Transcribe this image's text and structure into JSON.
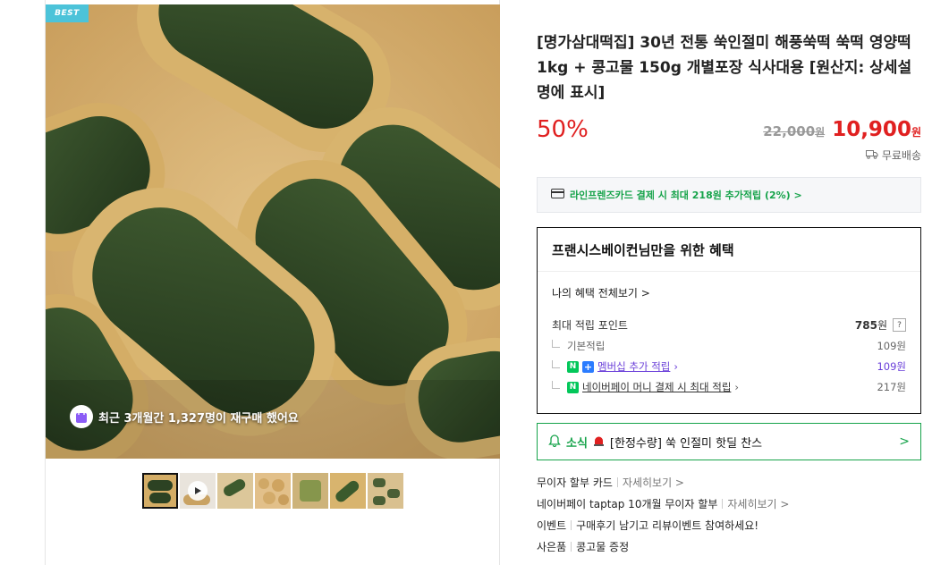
{
  "gallery": {
    "badge": "BEST",
    "repurchase_text": "최근 3개월간 1,327명이 재구매 했어요",
    "thumb_count": 7
  },
  "product": {
    "title": "[명가삼대떡집] 30년 전통 쑥인절미 해풍쑥떡 쑥떡 영양떡 1kg + 콩고물 150g 개별포장 식사대용 [원산지: 상세설명에 표시]",
    "discount": "50%",
    "original_price": "22,000",
    "original_unit": "원",
    "sale_price": "10,900",
    "sale_unit": "원",
    "shipping": "무료배송"
  },
  "card_promo": "라인프렌즈카드 결제 시 최대 218원 추가적립 (2%) >",
  "benefit": {
    "title": "프랜시스베이컨님만을 위한 혜택",
    "view_all": "나의 혜택 전체보기 >",
    "max_points_label": "최대 적립 포인트",
    "max_points_value": "785",
    "max_points_unit": "원",
    "qmark": "?",
    "basic_label": "기본적립",
    "basic_value": "109원",
    "membership_label": "멤버십 추가 적립",
    "membership_value": "109원",
    "npay_label": "네이버페이 머니 결제 시 최대 적립",
    "npay_value": "217원"
  },
  "news": {
    "label": "소식",
    "text": "[한정수량] 쑥 인절미 핫딜 찬스",
    "chevron": ">"
  },
  "info_rows": [
    {
      "label": "무이자 할부 카드",
      "link": "자세히보기 >"
    },
    {
      "label": "네이버페이 taptap 10개월 무이자 할부",
      "link": "자세히보기 >"
    },
    {
      "label": "이벤트",
      "link": "구매후기 남기고 리뷰이벤트 참여하세요!"
    },
    {
      "label": "사은품",
      "link": "콩고물 증정"
    }
  ],
  "colors": {
    "accent_red": "#e02020",
    "naver_green": "#16a34a",
    "badge_cyan": "#4cc3d9",
    "membership_purple": "#6a3fd9"
  }
}
